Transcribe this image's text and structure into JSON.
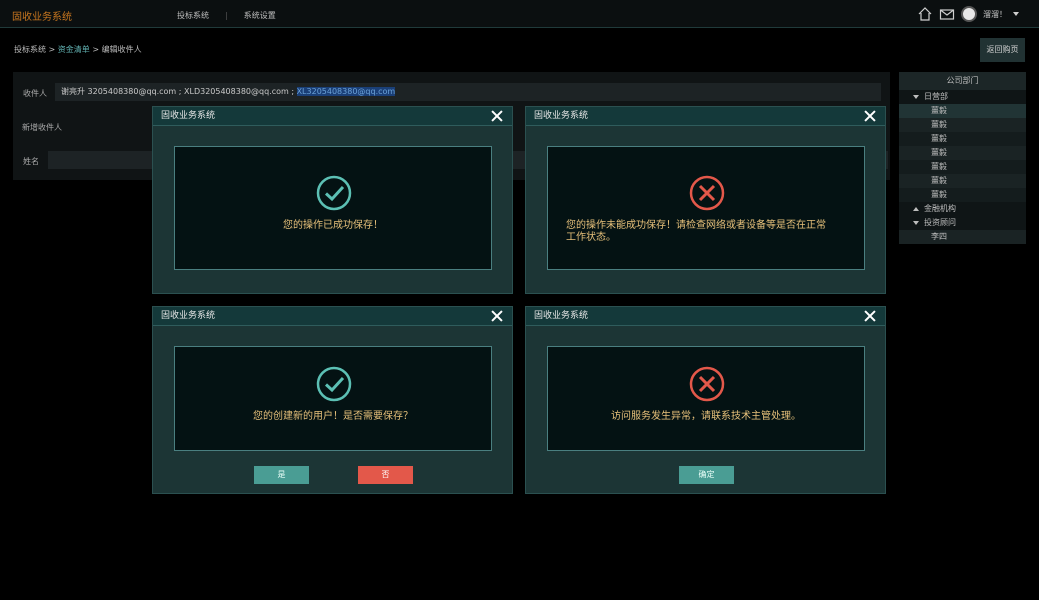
{
  "app": {
    "title": "固收业务系统"
  },
  "nav": {
    "items": [
      "投标系统",
      "系统设置"
    ]
  },
  "user": {
    "name": "溜溜！"
  },
  "breadcrumb": {
    "part1": "投标系统 > ",
    "part2": "资金清单",
    "part3": " > 编辑收件人"
  },
  "return_button": "返回购页",
  "form": {
    "recipient_label": "收件人",
    "recipient_value_plain": "谢亮升 3205408380@qq.com ; XLD3205408380@qq.com ; ",
    "recipient_value_highlight": "XL3205408380@qq.com",
    "add_recipient": "新增收件人",
    "name_label": "姓名"
  },
  "department": {
    "title": "公司部门",
    "groups": [
      {
        "name": "日营部",
        "expanded": true,
        "items": [
          "薑毅",
          "薑毅",
          "薑毅",
          "薑毅",
          "薑毅",
          "薑毅",
          "薑毅"
        ]
      },
      {
        "name": "金融机构",
        "expanded": false,
        "items": []
      },
      {
        "name": "投资顾问",
        "expanded": true,
        "items": [
          "李四"
        ]
      }
    ]
  },
  "dialogs": [
    {
      "title": "固收业务系统",
      "icon": "success-check-icon",
      "message_lines": [
        "您的操作已成功保存！"
      ]
    },
    {
      "title": "固收业务系统",
      "icon": "error-x-icon",
      "message_lines": [
        "您的操作未能成功保存！请检查网络或者设备等是否在正常",
        "工作状态。"
      ]
    },
    {
      "title": "固收业务系统",
      "icon": "success-check-icon",
      "message_lines": [
        "您的创建新的用户！是否需要保存？"
      ],
      "buttons": [
        "是",
        "否"
      ]
    },
    {
      "title": "固收业务系统",
      "icon": "error-x-icon",
      "message_lines": [
        "访问服务发生异常，请联系技术主管处理。"
      ],
      "buttons": [
        "确定"
      ]
    }
  ],
  "colors": {
    "logo": "#c8761f",
    "success": "#5cc0b4",
    "error": "#e3584a",
    "message": "#e6c07a",
    "accent_link": "#63b4b4"
  }
}
